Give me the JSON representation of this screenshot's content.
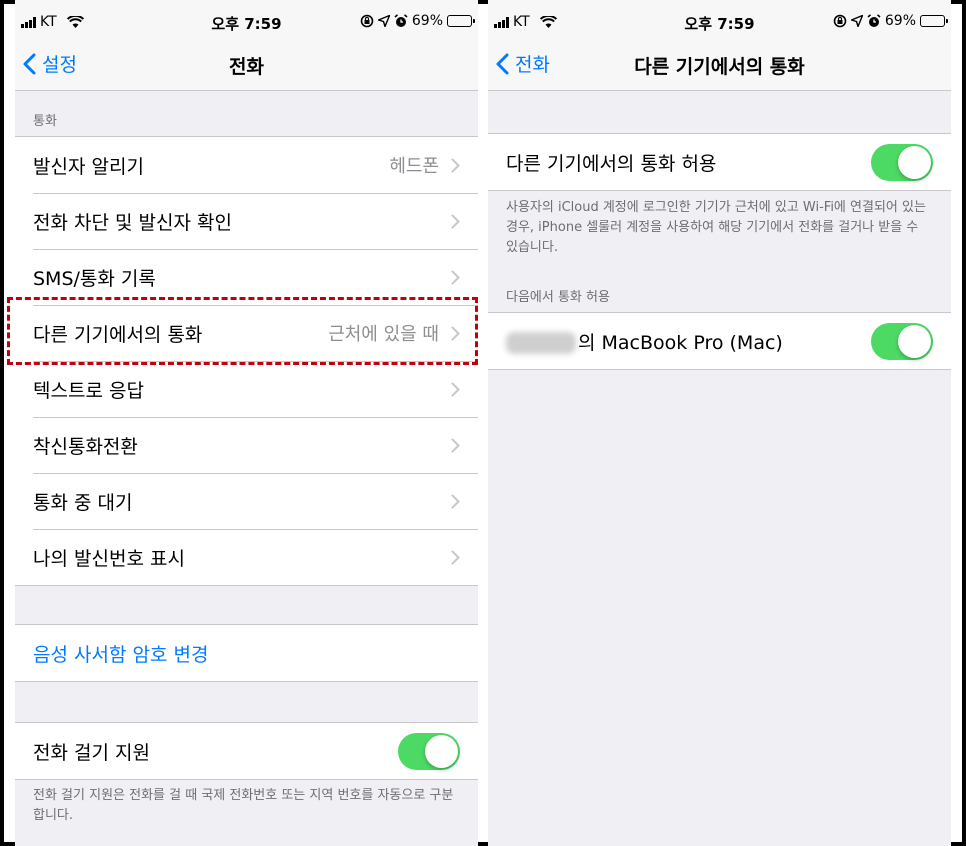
{
  "colors": {
    "accent": "#007aff",
    "toggle_on": "#4cd964",
    "highlight": "#c0000a"
  },
  "status_bar": {
    "carrier": "KT",
    "time": "오후 7:59",
    "battery_percent": "69%",
    "battery_level": 0.69,
    "icons": [
      "signal-icon",
      "wifi-icon",
      "rotation-lock-icon",
      "location-icon",
      "alarm-icon",
      "battery-icon"
    ]
  },
  "left": {
    "nav": {
      "back_label": "설정",
      "title": "전화"
    },
    "section_header": "통화",
    "rows": [
      {
        "label": "발신자 알리기",
        "value": "헤드폰"
      },
      {
        "label": "전화 차단 및 발신자 확인",
        "value": ""
      },
      {
        "label": "SMS/통화 기록",
        "value": ""
      },
      {
        "label": "다른 기기에서의 통화",
        "value": "근처에 있을 때"
      },
      {
        "label": "텍스트로 응답",
        "value": ""
      },
      {
        "label": "착신통화전환",
        "value": ""
      },
      {
        "label": "통화 중 대기",
        "value": ""
      },
      {
        "label": "나의 발신번호 표시",
        "value": ""
      }
    ],
    "voicemail_link": "음성 사서함 암호 변경",
    "dial_assist": {
      "label": "전화 걸기 지원",
      "on": true,
      "footer": "전화 걸기 지원은 전화를 걸 때 국제 전화번호 또는 지역 번호를 자동으로 구분합니다."
    }
  },
  "right": {
    "nav": {
      "back_label": "전화",
      "title": "다른 기기에서의 통화"
    },
    "allow_row": {
      "label": "다른 기기에서의 통화 허용",
      "on": true
    },
    "allow_footer": "사용자의 iCloud 계정에 로그인한 기기가 근처에 있고 Wi-Fi에 연결되어 있는 경우, iPhone 셀룰러 계정을 사용하여 해당 기기에서 전화를 걸거나 받을 수 있습니다.",
    "devices_header": "다음에서 통화 허용",
    "device_row": {
      "label": "의 MacBook Pro (Mac)",
      "on": true
    }
  }
}
